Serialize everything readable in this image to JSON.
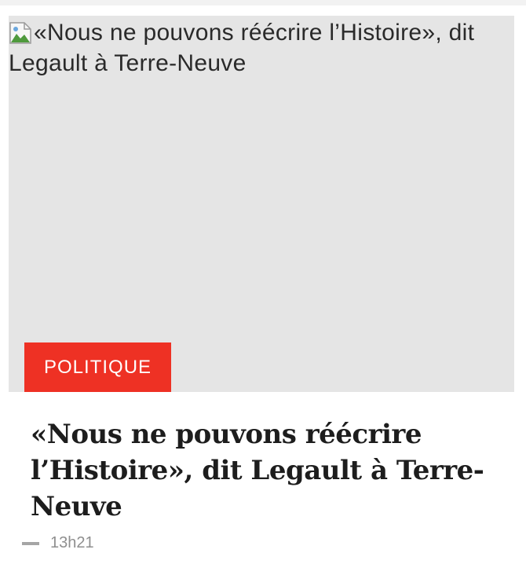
{
  "article": {
    "image_alt": "«Nous ne pouvons réécrire l’Histoire», dit Legault à Terre-Neuve",
    "category": "POLITIQUE",
    "headline": "«Nous ne pouvons réécrire l’Histoire», dit Legault à Terre-Neuve",
    "time": "13h21"
  },
  "colors": {
    "badge": "#ee3124",
    "image_placeholder": "#e5e5e5"
  },
  "icons": {
    "broken_image": "broken-image-icon",
    "meta_separator": "dash"
  }
}
